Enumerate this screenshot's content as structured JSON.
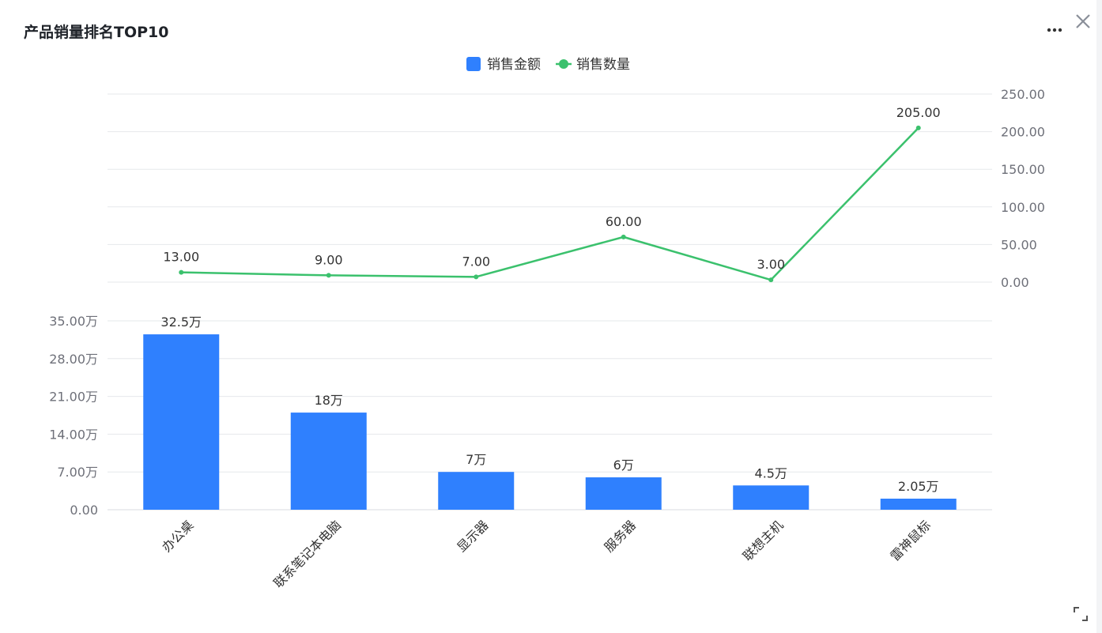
{
  "window": {
    "title": "产品销量排名TOP10"
  },
  "icons": {
    "more": "more-horizontal-icon",
    "close": "close-icon",
    "resize": "expand-icon"
  },
  "colors": {
    "bar": "#2f80fe",
    "line": "#3bc16d",
    "grid": "#e6e8eb",
    "axis_text": "#6e7079",
    "label_text": "#333333"
  },
  "chart_data": {
    "type": "bar",
    "title": "产品销量排名TOP10",
    "legend": {
      "position": "top-center",
      "items": [
        "销售金额",
        "销售数量"
      ]
    },
    "categories": [
      "办公桌",
      "联系笔记本电脑",
      "显示器",
      "服务器",
      "联想主机",
      "雷神鼠标"
    ],
    "series": [
      {
        "name": "销售金额",
        "type": "bar",
        "values": [
          325000,
          180000,
          70000,
          60000,
          45000,
          20500
        ],
        "labels": [
          "32.5万",
          "18万",
          "7万",
          "6万",
          "4.5万",
          "2.05万"
        ],
        "axis": "left-bottom",
        "ylim": [
          0,
          350000
        ],
        "ticks": [
          "0.00",
          "7.00万",
          "14.00万",
          "21.00万",
          "28.00万",
          "35.00万"
        ]
      },
      {
        "name": "销售数量",
        "type": "line",
        "values": [
          13,
          9,
          7,
          60,
          3,
          205
        ],
        "labels": [
          "13.00",
          "9.00",
          "7.00",
          "60.00",
          "3.00",
          "205.00"
        ],
        "axis": "right-top",
        "ylim": [
          0,
          250
        ],
        "ticks": [
          "0.00",
          "50.00",
          "100.00",
          "150.00",
          "200.00",
          "250.00"
        ]
      }
    ],
    "grid": true
  }
}
